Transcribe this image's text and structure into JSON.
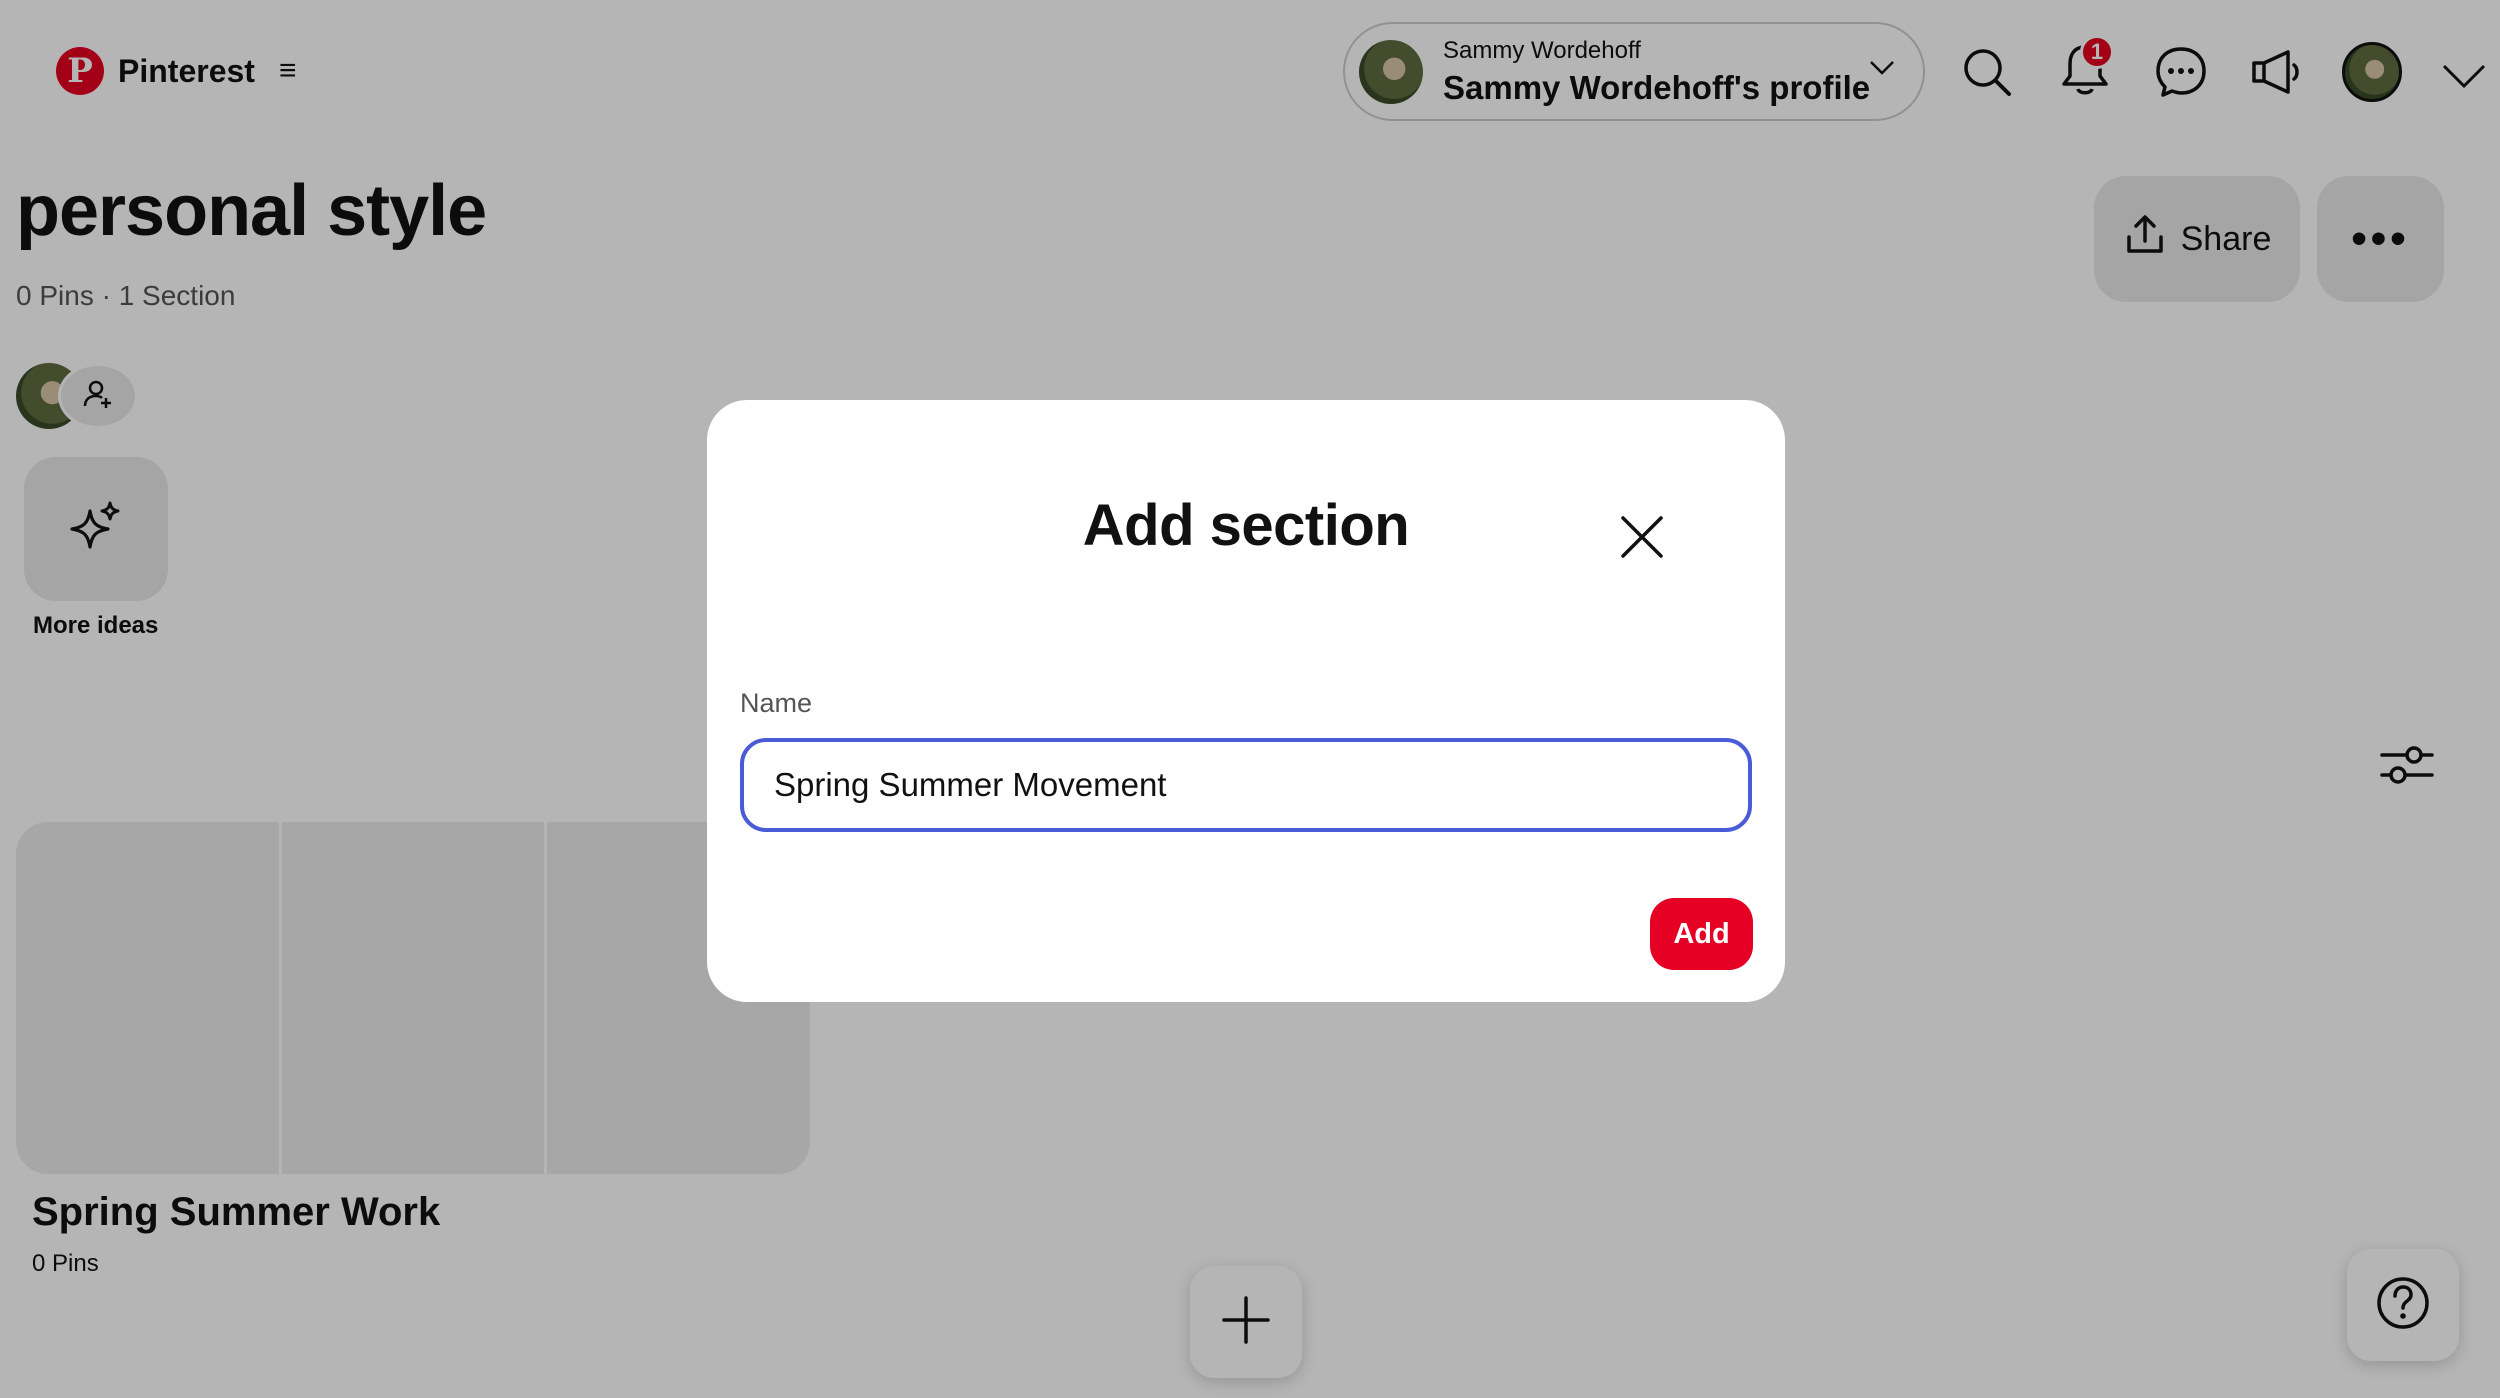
{
  "header": {
    "brand": "Pinterest",
    "profile_switcher": {
      "account_name": "Sammy Wordehoff",
      "profile_label": "Sammy Wordehoff's profile"
    },
    "notifications_count": "1",
    "icons": [
      "pinterest-logo-icon",
      "menu-icon",
      "chevron-down-icon",
      "search-icon",
      "bell-icon",
      "messages-icon",
      "megaphone-icon",
      "chevron-down-icon"
    ]
  },
  "board": {
    "title": "personal style",
    "meta": "0 Pins · 1 Section",
    "share_label": "Share",
    "more_ideas_label": "More ideas",
    "sections": [
      {
        "name": "Spring Summer Work",
        "count": "0 Pins"
      }
    ]
  },
  "modal": {
    "title": "Add section",
    "name_label": "Name",
    "name_value": "Spring Summer Movement",
    "add_label": "Add"
  },
  "colors": {
    "brand_red": "#e60023",
    "input_focus": "#4a5bd6",
    "overlay": "rgba(0,0,0,0.29)"
  }
}
